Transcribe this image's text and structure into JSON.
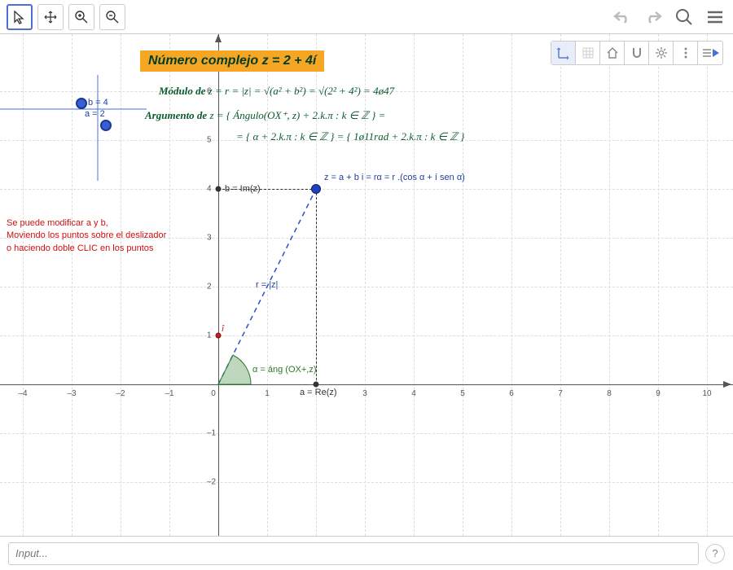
{
  "title": "Número complejo z = 2 + 4í",
  "math": {
    "modulo_label": "Módulo de",
    "modulo_expr": "z = r = |z| = √(a² + b²) = √(2² + 4²) = 4ø47",
    "argumento_label": "Argumento de",
    "argumento_expr1": "z = { Ángulo(OX⁺, z) + 2.k.π  : k ∈ ℤ } =",
    "argumento_expr2": "= { α + 2.k.π  : k ∈ ℤ } = { 1ø11rad + 2.k.π  : k ∈ ℤ }"
  },
  "instructions": {
    "line1": "Se puede modificar a y b,",
    "line2": "Moviendo los puntos sobre el deslizador",
    "line3": "o haciendo doble CLIC en los puntos"
  },
  "plot": {
    "z_formula": "z = a + b i = rα = r .(cos α + í sen α)",
    "b_im": "b = Im(z)",
    "a_re": "a = Re(z)",
    "r_mag": "r = |z|",
    "alpha": "α = áng (OX+,z)",
    "i_hat": "î"
  },
  "sliders": {
    "a_label": "a = 2",
    "b_label": "b = 4"
  },
  "axes": {
    "x_ticks": [
      -4,
      -3,
      -2,
      -1,
      0,
      1,
      2,
      3,
      4,
      5,
      6,
      7,
      8,
      9,
      10
    ],
    "y_ticks": [
      -2,
      -1,
      1,
      2,
      3,
      4,
      5,
      6
    ]
  },
  "input_placeholder": "Input...",
  "chart_data": {
    "type": "scatter",
    "title": "Número complejo z = 2 + 4i",
    "xlabel": "Re(z)",
    "ylabel": "Im(z)",
    "xlim": [
      -4.5,
      10.5
    ],
    "ylim": [
      -2.5,
      6.5
    ],
    "points": [
      {
        "name": "z",
        "x": 2,
        "y": 4,
        "color": "#2040c0"
      },
      {
        "name": "i_hat",
        "x": 0,
        "y": 1,
        "color": "#c02020"
      },
      {
        "name": "a_real_proj",
        "x": 2,
        "y": 0,
        "color": "#333"
      },
      {
        "name": "b_imag_proj",
        "x": 0,
        "y": 4,
        "color": "#333"
      }
    ],
    "vectors": [
      {
        "from": [
          0,
          0
        ],
        "to": [
          2,
          4
        ],
        "label": "r = |z|",
        "style": "dashed",
        "color": "#2040a0"
      }
    ],
    "guides": [
      {
        "from": [
          2,
          0
        ],
        "to": [
          2,
          4
        ],
        "style": "dashed"
      },
      {
        "from": [
          0,
          4
        ],
        "to": [
          2,
          4
        ],
        "style": "dashed"
      }
    ],
    "angle": {
      "vertex": [
        0,
        0
      ],
      "from_axis": "OX+",
      "value_rad": 1.107,
      "label": "α"
    },
    "parameters": {
      "a": 2,
      "b": 4,
      "r_approx": 4.47,
      "alpha_rad_approx": 1.11
    }
  }
}
